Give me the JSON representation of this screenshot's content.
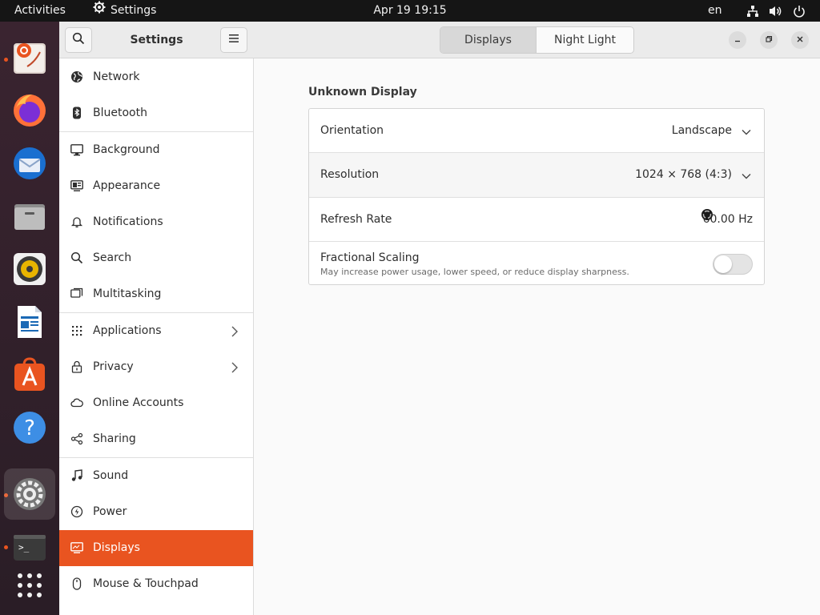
{
  "topbar": {
    "activities": "Activities",
    "app_name": "Settings",
    "clock": "Apr 19  19:15",
    "language": "en",
    "tray_icons": [
      "network-icon",
      "volume-icon",
      "power-icon"
    ]
  },
  "dock": {
    "apps": [
      "ubuntu-help-icon",
      "firefox-icon",
      "thunderbird-icon",
      "files-icon",
      "rhythmbox-icon",
      "libreoffice-writer-icon",
      "app-center-icon",
      "help-icon",
      "settings-icon",
      "terminal-icon",
      "show-apps-icon"
    ],
    "accent": "#e95420"
  },
  "sidebar": {
    "title": "Settings",
    "items": [
      {
        "label": "Network",
        "icon": "globe-icon"
      },
      {
        "label": "Bluetooth",
        "icon": "bluetooth-icon"
      },
      {
        "label": "Background",
        "icon": "monitor-icon"
      },
      {
        "label": "Appearance",
        "icon": "appearance-icon"
      },
      {
        "label": "Notifications",
        "icon": "bell-icon"
      },
      {
        "label": "Search",
        "icon": "search-icon"
      },
      {
        "label": "Multitasking",
        "icon": "multitasking-icon"
      },
      {
        "label": "Applications",
        "icon": "grid-icon",
        "has_submenu": true
      },
      {
        "label": "Privacy",
        "icon": "lock-icon",
        "has_submenu": true
      },
      {
        "label": "Online Accounts",
        "icon": "cloud-icon"
      },
      {
        "label": "Sharing",
        "icon": "share-icon"
      },
      {
        "label": "Sound",
        "icon": "music-note-icon"
      },
      {
        "label": "Power",
        "icon": "power-icon"
      },
      {
        "label": "Displays",
        "icon": "display-icon",
        "selected": true
      },
      {
        "label": "Mouse & Touchpad",
        "icon": "mouse-icon"
      }
    ],
    "selected_color": "#e95420"
  },
  "header": {
    "tabs": [
      {
        "label": "Displays",
        "active": true
      },
      {
        "label": "Night Light",
        "active": false
      }
    ]
  },
  "main": {
    "display_name": "Unknown Display",
    "orientation": {
      "label": "Orientation",
      "value": "Landscape"
    },
    "resolution": {
      "label": "Resolution",
      "value": "1024 × 768 (4:3)"
    },
    "refresh_rate": {
      "label": "Refresh Rate",
      "value": "60.00 Hz"
    },
    "fractional_scaling": {
      "label": "Fractional Scaling",
      "description": "May increase power usage, lower speed, or reduce display sharpness.",
      "enabled": false
    }
  }
}
